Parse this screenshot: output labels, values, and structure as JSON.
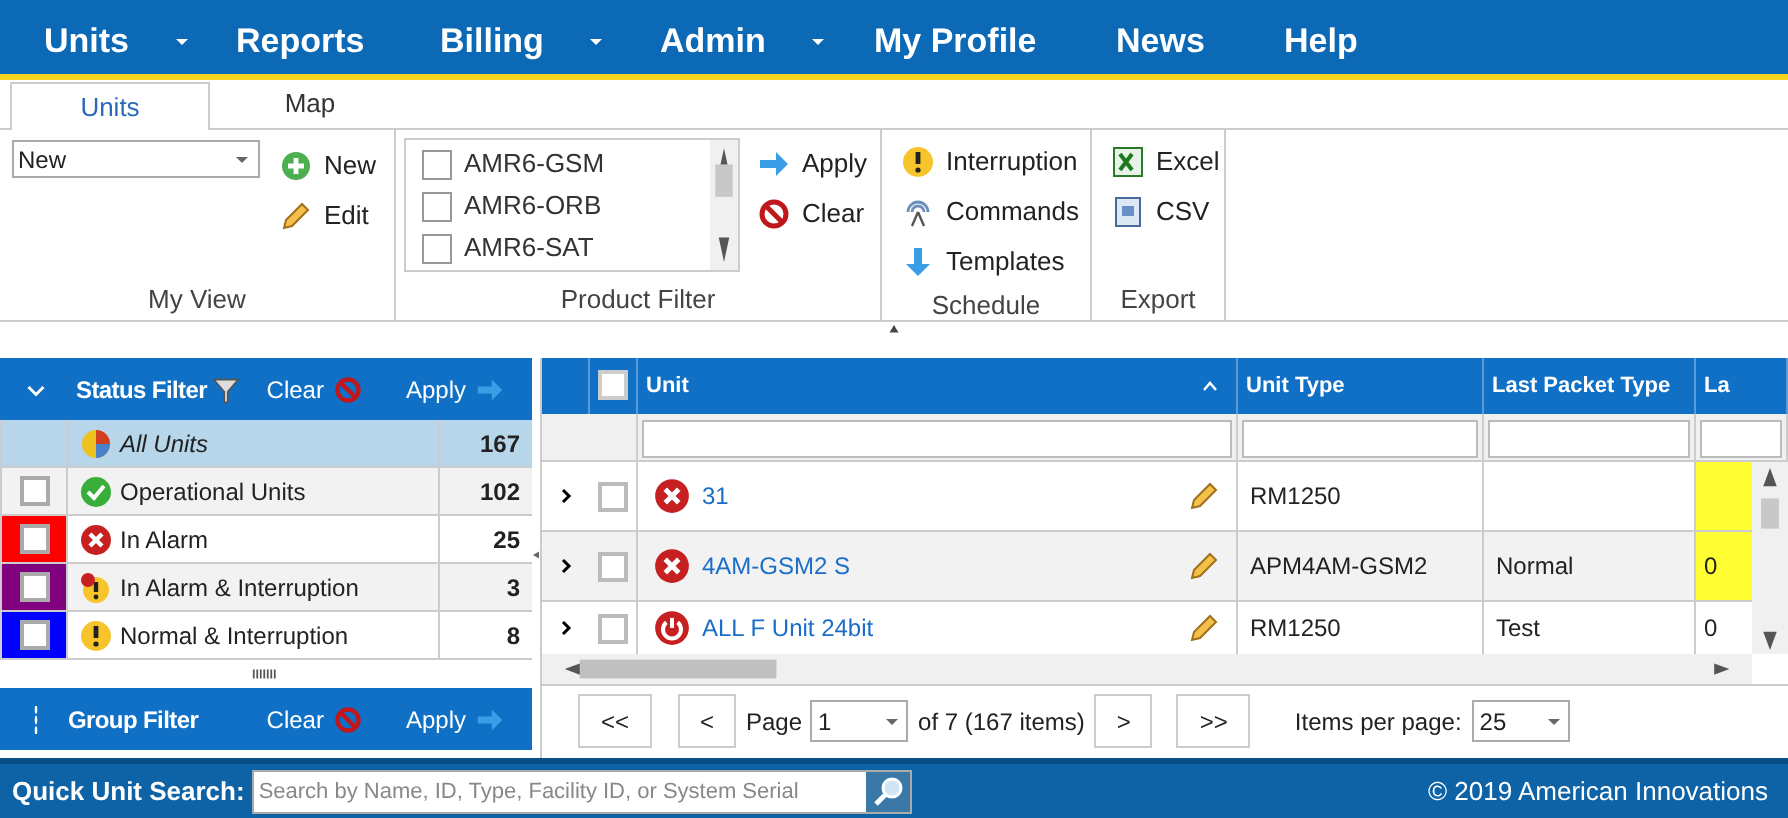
{
  "nav": [
    {
      "label": "Units",
      "dropdown": true
    },
    {
      "label": "Reports",
      "dropdown": false
    },
    {
      "label": "Billing",
      "dropdown": true
    },
    {
      "label": "Admin",
      "dropdown": true
    },
    {
      "label": "My Profile",
      "dropdown": false
    },
    {
      "label": "News",
      "dropdown": false
    },
    {
      "label": "Help",
      "dropdown": false
    }
  ],
  "tabs": [
    {
      "label": "Units",
      "selected": true
    },
    {
      "label": "Map",
      "selected": false
    }
  ],
  "ribbon": {
    "my_view": {
      "select_value": "New",
      "actions": [
        {
          "label": "New",
          "kind": "add"
        },
        {
          "label": "Edit",
          "kind": "edit"
        }
      ],
      "group_label": "My View"
    },
    "product_filter": {
      "options": [
        {
          "label": "AMR6-GSM",
          "checked": false
        },
        {
          "label": "AMR6-ORB",
          "checked": false
        },
        {
          "label": "AMR6-SAT",
          "checked": false
        }
      ],
      "actions": [
        {
          "label": "Apply",
          "kind": "apply"
        },
        {
          "label": "Clear",
          "kind": "clear"
        }
      ],
      "group_label": "Product Filter"
    },
    "schedule": {
      "actions": [
        {
          "label": "Interruption",
          "kind": "warning"
        },
        {
          "label": "Commands",
          "kind": "signal"
        },
        {
          "label": "Templates",
          "kind": "download"
        }
      ],
      "group_label": "Schedule"
    },
    "export": {
      "actions": [
        {
          "label": "Excel",
          "kind": "excel"
        },
        {
          "label": "CSV",
          "kind": "csv"
        }
      ],
      "group_label": "Export"
    }
  },
  "status_filter": {
    "title": "Status Filter",
    "clear": "Clear",
    "apply": "Apply",
    "rows": [
      {
        "label": "All Units",
        "count": "167",
        "kind": "all",
        "selected": true
      },
      {
        "label": "Operational Units",
        "count": "102",
        "kind": "ok",
        "selected": false,
        "checked": false
      },
      {
        "label": "In Alarm",
        "count": "25",
        "kind": "alarm",
        "selected": false,
        "checked": false,
        "color": "#ff0000"
      },
      {
        "label": "In Alarm & Interruption",
        "count": "3",
        "kind": "alarm_interrupt",
        "selected": false,
        "checked": false,
        "color": "#800080"
      },
      {
        "label": "Normal & Interruption",
        "count": "8",
        "kind": "interrupt",
        "selected": false,
        "checked": false,
        "color": "#0000ff"
      }
    ]
  },
  "group_filter": {
    "title": "Group Filter",
    "clear": "Clear",
    "apply": "Apply"
  },
  "table": {
    "columns": [
      "Unit",
      "Unit Type",
      "Last Packet Type",
      "La"
    ],
    "header_checked": false,
    "rows": [
      {
        "unit": "31",
        "kind": "alarm",
        "unit_type": "RM1250",
        "last_packet_type": "",
        "column_4": "",
        "highlight": true,
        "checked": false
      },
      {
        "unit": "4AM-GSM2 S",
        "kind": "alarm",
        "unit_type": "APM4AM-GSM2",
        "last_packet_type": "Normal",
        "column_4": "0",
        "highlight": true,
        "checked": false
      },
      {
        "unit": "ALL F Unit 24bit",
        "kind": "power",
        "unit_type": "RM1250",
        "last_packet_type": "Test",
        "column_4": "0",
        "highlight": false,
        "checked": false
      }
    ]
  },
  "pager": {
    "first": "<<",
    "prev": "<",
    "page_label": "Page",
    "page": "1",
    "of": "of 7 (167 items)",
    "next": ">",
    "last": ">>",
    "per_page_label": "Items per page:",
    "per_page": "25"
  },
  "footer": {
    "search_label": "Quick Unit Search:",
    "search_placeholder": "Search by Name, ID, Type, Facility ID, or System Serial",
    "copyright": "© 2019 American Innovations"
  }
}
